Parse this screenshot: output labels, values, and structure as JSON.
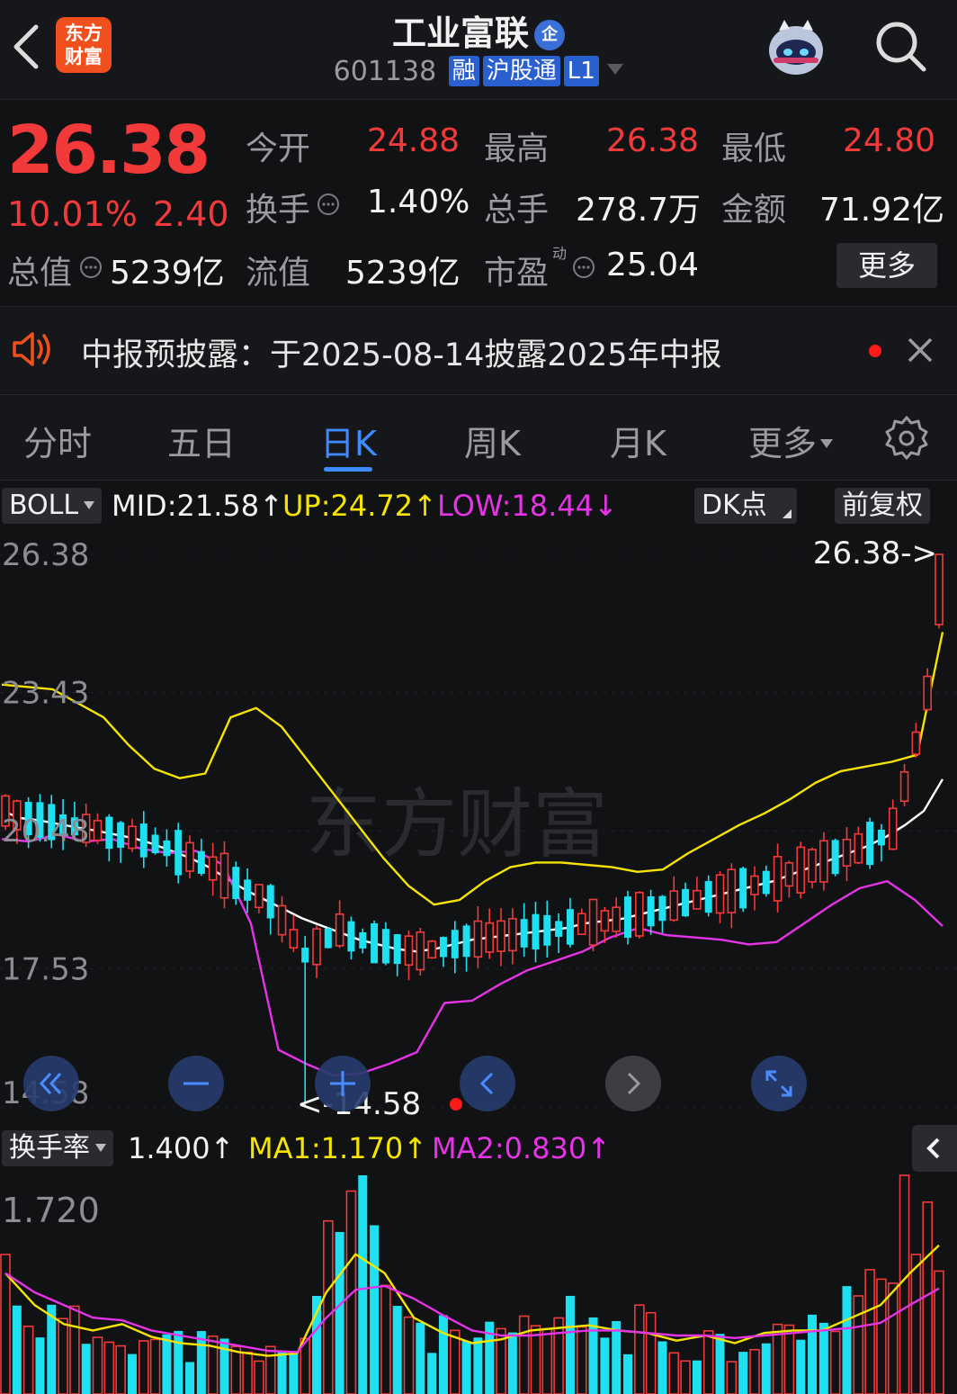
{
  "header": {
    "logo_line1": "东方",
    "logo_line2": "财富",
    "stock_name": "工业富联",
    "enterprise_badge": "企",
    "stock_code": "601138",
    "tags": [
      "融",
      "沪股通",
      "L1"
    ]
  },
  "quote": {
    "price": "26.38",
    "change_pct": "10.01%",
    "change_amt": "2.40",
    "fields": [
      {
        "label": "今开",
        "value": "24.88",
        "color": "red"
      },
      {
        "label": "最高",
        "value": "26.38",
        "color": "red"
      },
      {
        "label": "最低",
        "value": "24.80",
        "color": "red"
      },
      {
        "label": "换手",
        "value": "1.40%",
        "color": "white"
      },
      {
        "label": "总手",
        "value": "278.7万",
        "color": "white"
      },
      {
        "label": "金额",
        "value": "71.92亿",
        "color": "white"
      },
      {
        "label": "总值",
        "value": "5239亿",
        "color": "white"
      },
      {
        "label": "流值",
        "value": "5239亿",
        "color": "white"
      },
      {
        "label": "市盈",
        "value": "25.04",
        "color": "white"
      }
    ],
    "pe_superscript": "动",
    "more_label": "更多"
  },
  "notice": {
    "text": "中报预披露：于2025-08-14披露2025年中报"
  },
  "tabs": [
    {
      "label": "分时",
      "active": false
    },
    {
      "label": "五日",
      "active": false
    },
    {
      "label": "日K",
      "active": true
    },
    {
      "label": "周K",
      "active": false
    },
    {
      "label": "月K",
      "active": false
    },
    {
      "label": "更多",
      "active": false
    }
  ],
  "indicator_bar": {
    "selector": "BOLL",
    "mid": "MID:21.58",
    "up": "UP:24.72",
    "low": "LOW:18.44",
    "dk_label": "DK点",
    "adjust_label": "前复权"
  },
  "main_chart": {
    "y_labels": [
      "26.38",
      "23.43",
      "20.48",
      "17.53",
      "14.58"
    ],
    "high_marker": "26.38->",
    "low_marker": "<-14.58",
    "watermark": "东方财富"
  },
  "volume_bar": {
    "selector": "换手率",
    "value": "1.400",
    "ma1": "MA1:1.170",
    "ma2": "MA2:0.830",
    "y_label": "1.720"
  },
  "colors": {
    "up": "#f23a3a",
    "down": "#1ee0f0",
    "boll_up": "#f5e400",
    "boll_mid": "#ffffff",
    "boll_low": "#e633e6",
    "accent": "#3d8bff"
  },
  "chart_data": {
    "type": "candlestick",
    "ylim": [
      14.58,
      26.38
    ],
    "series": [
      {
        "name": "MID",
        "values": [
          20.9,
          20.75,
          20.7,
          20.62,
          20.55,
          20.48,
          20.4,
          20.32,
          20.2,
          20.05,
          19.9,
          19.7,
          19.45,
          19.2,
          19.0,
          18.8,
          18.6,
          18.45,
          18.3,
          18.15,
          18.05,
          17.95,
          17.9,
          17.95,
          18.05,
          18.15,
          18.2,
          18.25,
          18.3,
          18.35,
          18.4,
          18.5,
          18.55,
          18.6,
          18.7,
          18.8,
          18.9,
          19.0,
          19.1,
          19.2,
          19.3,
          19.4,
          19.55,
          19.7,
          19.85,
          20.0,
          20.15,
          20.35,
          20.6,
          20.9,
          21.58
        ]
      },
      {
        "name": "UP",
        "values": [
          23.6,
          23.55,
          23.5,
          23.2,
          22.9,
          22.3,
          21.8,
          21.6,
          21.7,
          22.9,
          23.1,
          22.7,
          22.0,
          21.3,
          20.6,
          19.9,
          19.3,
          18.9,
          19.0,
          19.4,
          19.7,
          19.8,
          19.8,
          19.75,
          19.7,
          19.6,
          19.65,
          20.0,
          20.3,
          20.6,
          20.85,
          21.15,
          21.5,
          21.75,
          21.85,
          21.95,
          22.1,
          24.72
        ]
      },
      {
        "name": "LOW",
        "values": [
          20.3,
          20.25,
          20.4,
          20.25,
          20.3,
          20.1,
          20.0,
          20.05,
          19.75,
          18.5,
          15.8,
          15.5,
          15.25,
          15.3,
          15.5,
          15.75,
          16.8,
          16.85,
          17.2,
          17.5,
          17.7,
          17.9,
          18.2,
          18.4,
          18.25,
          18.2,
          18.15,
          18.05,
          18.1,
          18.5,
          18.9,
          19.25,
          19.4,
          19.0,
          18.44
        ]
      },
      {
        "name": "换手率",
        "values": [
          0.98,
          0.6,
          0.54,
          0.45,
          0.55,
          0.4,
          0.39,
          0.38,
          0.3,
          0.31,
          0.28,
          1.35,
          1.4,
          0.98,
          0.55,
          0.45,
          0.42,
          0.4,
          0.5,
          0.56,
          0.6,
          0.48,
          0.52,
          0.37,
          0.46,
          0.34,
          0.55,
          0.46,
          0.48,
          0.9,
          0.7,
          1.72,
          1.4
        ]
      },
      {
        "name": "MA1",
        "values": [
          0.95,
          0.7,
          0.55,
          0.5,
          0.55,
          0.45,
          0.4,
          0.38,
          0.33,
          0.3,
          0.32,
          0.8,
          1.1,
          0.95,
          0.6,
          0.48,
          0.4,
          0.43,
          0.5,
          0.52,
          0.54,
          0.5,
          0.48,
          0.42,
          0.46,
          0.4,
          0.48,
          0.5,
          0.5,
          0.6,
          0.7,
          0.95,
          1.17
        ]
      },
      {
        "name": "MA2",
        "values": [
          0.95,
          0.8,
          0.7,
          0.6,
          0.58,
          0.5,
          0.46,
          0.42,
          0.38,
          0.34,
          0.33,
          0.6,
          0.82,
          0.85,
          0.75,
          0.62,
          0.5,
          0.46,
          0.46,
          0.48,
          0.5,
          0.5,
          0.48,
          0.46,
          0.46,
          0.44,
          0.46,
          0.48,
          0.5,
          0.52,
          0.56,
          0.7,
          0.83
        ]
      }
    ]
  }
}
